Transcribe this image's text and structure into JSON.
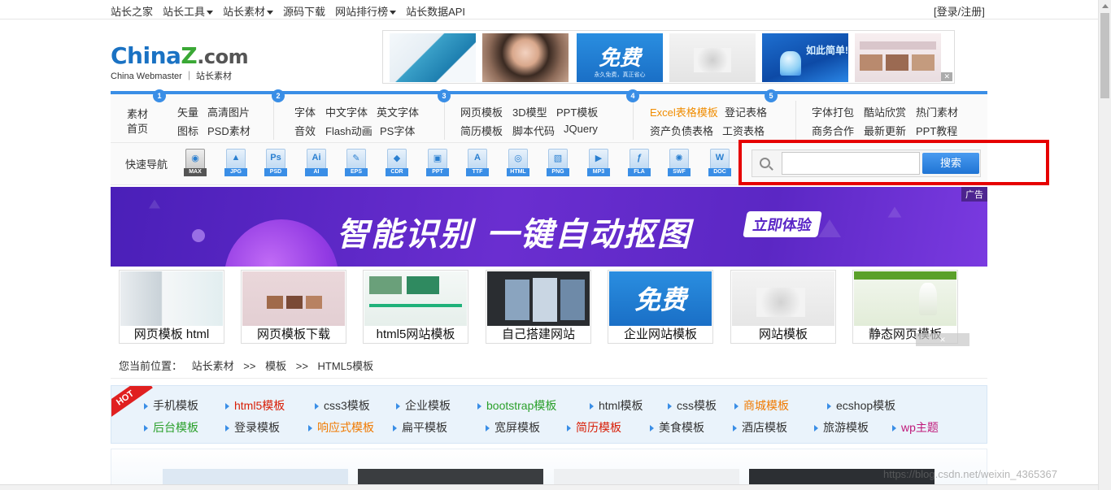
{
  "topnav": {
    "items": [
      {
        "label": "站长之家",
        "dropdown": false
      },
      {
        "label": "站长工具",
        "dropdown": true
      },
      {
        "label": "站长素材",
        "dropdown": true
      },
      {
        "label": "源码下载",
        "dropdown": false
      },
      {
        "label": "网站排行榜",
        "dropdown": true
      },
      {
        "label": "站长数据API",
        "dropdown": false
      }
    ],
    "login": "[登录/注册]"
  },
  "logo": {
    "brand_a": "China",
    "brand_z": "Z",
    "brand_b": ".com",
    "subtitle": "China Webmaster ｜ 站长素材"
  },
  "catmenu": {
    "home": [
      "素材",
      "首页"
    ],
    "groups": [
      {
        "num": "1",
        "links": [
          "矢量",
          "高清图片",
          "图标",
          "PSD素材"
        ]
      },
      {
        "num": "2",
        "links": [
          "字体",
          "中文字体",
          "英文字体",
          "音效",
          "Flash动画",
          "PS字体"
        ]
      },
      {
        "num": "3",
        "links": [
          "网页模板",
          "3D模型",
          "PPT模板",
          "简历模板",
          "脚本代码",
          "JQuery"
        ]
      },
      {
        "num": "4",
        "links": [
          "Excel表格模板",
          "登记表格",
          "资产负债表格",
          "工资表格"
        ]
      },
      {
        "num": "5",
        "links": [
          "字体打包",
          "酷站欣赏",
          "热门素材",
          "商务合作",
          "最新更新",
          "PPT教程"
        ]
      }
    ]
  },
  "quicknav": {
    "label": "快速导航",
    "icons": [
      "MAX",
      "JPG",
      "PSD",
      "AI",
      "EPS",
      "CDR",
      "PPT",
      "TTF",
      "HTML",
      "PNG",
      "MP3",
      "FLA",
      "SWF",
      "DOC"
    ],
    "glyphs": [
      "◉",
      "▲",
      "Ps",
      "Ai",
      "✎",
      "◆",
      "▣",
      "A",
      "◎",
      "▧",
      "▶",
      "ƒ",
      "✺",
      "W"
    ]
  },
  "search": {
    "value": "",
    "button": "搜索"
  },
  "banner": {
    "headline": "智能识别 一键自动抠图",
    "cta": "立即体验",
    "ad_tag": "广告"
  },
  "templates": [
    {
      "caption": "网页模板 html"
    },
    {
      "caption": "网页模板下载"
    },
    {
      "caption": "html5网站模板"
    },
    {
      "caption": "自己搭建网站"
    },
    {
      "caption": "企业网站模板"
    },
    {
      "caption": "网站模板"
    },
    {
      "caption": "静态网页模板"
    }
  ],
  "breadcrumb": {
    "prefix": "您当前位置：",
    "items": [
      "站长素材",
      ">>",
      "模板",
      ">>",
      "HTML5模板"
    ]
  },
  "tags": {
    "hot": "HOT",
    "row1": [
      {
        "label": "手机模板",
        "color": "default"
      },
      {
        "label": "html5模板",
        "color": "red"
      },
      {
        "label": "css3模板",
        "color": "default"
      },
      {
        "label": "企业模板",
        "color": "default"
      },
      {
        "label": "bootstrap模板",
        "color": "green"
      },
      {
        "label": "html模板",
        "color": "default"
      },
      {
        "label": "css模板",
        "color": "default"
      },
      {
        "label": "商城模板",
        "color": "orange"
      },
      {
        "label": "ecshop模板",
        "color": "default"
      }
    ],
    "row2": [
      {
        "label": "后台模板",
        "color": "green"
      },
      {
        "label": "登录模板",
        "color": "default"
      },
      {
        "label": "响应式模板",
        "color": "orange"
      },
      {
        "label": "扁平模板",
        "color": "default"
      },
      {
        "label": "宽屏模板",
        "color": "default"
      },
      {
        "label": "简历模板",
        "color": "red"
      },
      {
        "label": "美食模板",
        "color": "default"
      },
      {
        "label": "酒店模板",
        "color": "default"
      },
      {
        "label": "旅游模板",
        "color": "default"
      },
      {
        "label": "wp主题",
        "color": "purple"
      }
    ]
  },
  "watermark": "https://blog.csdn.net/weixin_4365367"
}
